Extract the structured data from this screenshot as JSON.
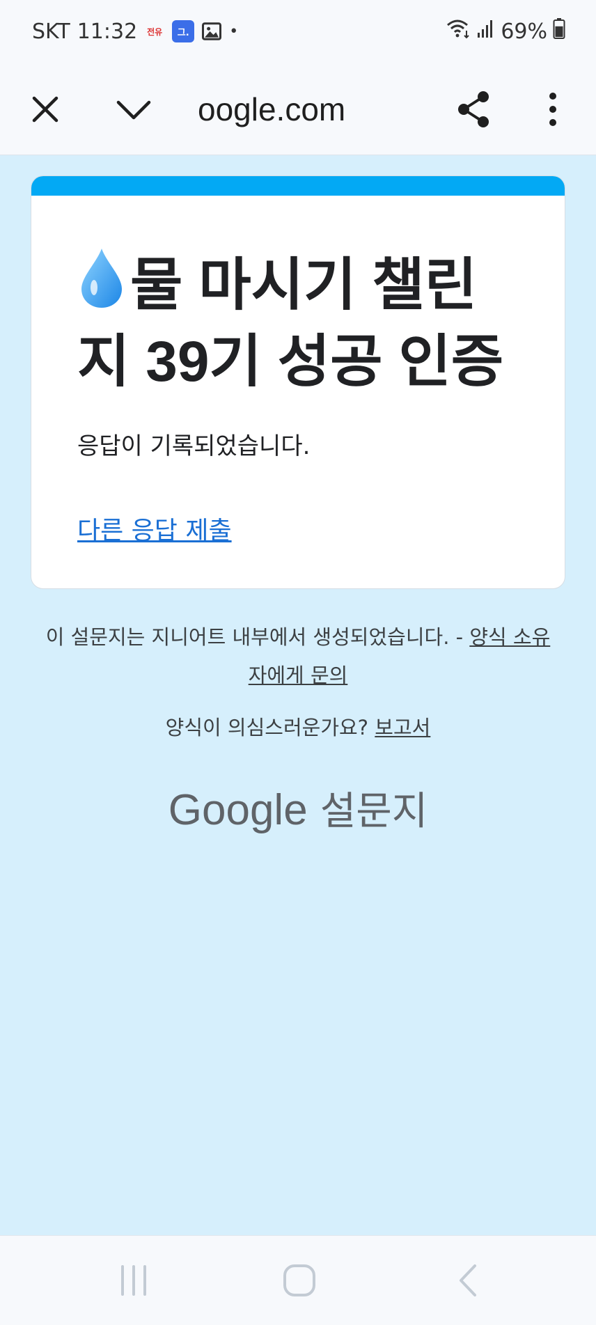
{
  "status_bar": {
    "carrier": "SKT",
    "time": "11:32",
    "notif_red_label": "전유",
    "notif_blue_label": "그.",
    "battery_percent": "69%",
    "battery_level": 0.69
  },
  "browser": {
    "url": "oogle.com",
    "close_icon": "close-icon",
    "minimize_icon": "chevron-down-icon",
    "share_icon": "share-icon",
    "menu_icon": "more-vert-icon"
  },
  "card": {
    "accent_color": "#03a9f4",
    "title": "물 마시기 챌린지 39기 성공 인증",
    "message": "응답이 기록되었습니다.",
    "link_label": "다른 응답 제출"
  },
  "footer": {
    "created_text": "이 설문지는 지니어트 내부에서 생성되었습니다. - ",
    "contact_link": "양식 소유자에게 문의",
    "report_text": "양식이 의심스러운가요? ",
    "report_link": "보고서",
    "brand_google": "Google",
    "brand_forms": "설문지"
  },
  "colors": {
    "page_background": "#d6effc",
    "link_blue": "#1a6fd4"
  }
}
